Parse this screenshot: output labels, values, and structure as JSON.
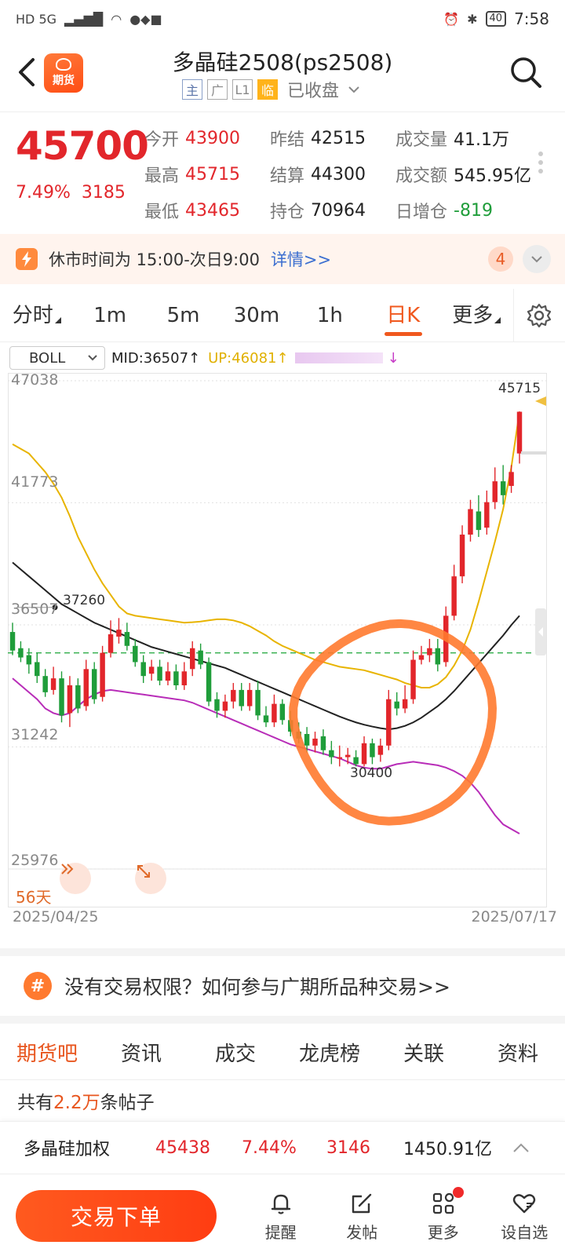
{
  "status_bar": {
    "left_text": "HD 5G",
    "time": "7:58",
    "battery": "40"
  },
  "header": {
    "logo_text": "期货",
    "title": "多晶硅2508(ps2508)",
    "tags": [
      "主",
      "广",
      "L1",
      "临"
    ],
    "market_status": "已收盘"
  },
  "quote": {
    "last_price": "45700",
    "change_pct": "7.49%",
    "change": "3185",
    "rows": [
      [
        {
          "label": "今开",
          "value": "43900",
          "color": "red"
        },
        {
          "label": "昨结",
          "value": "42515",
          "color": "dark"
        },
        {
          "label": "成交量",
          "value": "41.1万",
          "color": "dark"
        }
      ],
      [
        {
          "label": "最高",
          "value": "45715",
          "color": "red"
        },
        {
          "label": "结算",
          "value": "44300",
          "color": "dark"
        },
        {
          "label": "成交额",
          "value": "545.95亿",
          "color": "dark"
        }
      ],
      [
        {
          "label": "最低",
          "value": "43465",
          "color": "red"
        },
        {
          "label": "持仓",
          "value": "70964",
          "color": "dark"
        },
        {
          "label": "日增仓",
          "value": "-819",
          "color": "green"
        }
      ]
    ]
  },
  "notice": {
    "text": "休市时间为 15:00-次日9:00",
    "link": "详情>>",
    "badge": "4"
  },
  "period_tabs": [
    {
      "label": "分时",
      "corner": true
    },
    {
      "label": "1m"
    },
    {
      "label": "5m"
    },
    {
      "label": "30m"
    },
    {
      "label": "1h"
    },
    {
      "label": "日K",
      "active": true
    },
    {
      "label": "更多",
      "corner": true
    }
  ],
  "indicator": {
    "select": "BOLL",
    "mid": "MID:36507",
    "up": "UP:46081"
  },
  "chart_data": {
    "type": "candlestick",
    "indicator": "BOLL",
    "y_ticks": [
      "47038",
      "41773",
      "36507",
      "31242",
      "25976"
    ],
    "ylim": [
      25976,
      47038
    ],
    "x_start": "2025/04/25",
    "x_end": "2025/07/17",
    "range_label": "56天",
    "reference_price": 35300,
    "high_label": "45715",
    "low_label": "30400",
    "prior_high_label": "37260",
    "candles": [
      {
        "o": 36200,
        "c": 35400,
        "h": 36600,
        "l": 35200
      },
      {
        "o": 35500,
        "c": 35100,
        "h": 35800,
        "l": 34900
      },
      {
        "o": 35200,
        "c": 34800,
        "h": 35500,
        "l": 34400
      },
      {
        "o": 34900,
        "c": 34300,
        "h": 35300,
        "l": 34000
      },
      {
        "o": 34300,
        "c": 33600,
        "h": 34600,
        "l": 33400
      },
      {
        "o": 33700,
        "c": 34200,
        "h": 34700,
        "l": 33500
      },
      {
        "o": 34200,
        "c": 32600,
        "h": 34500,
        "l": 32300
      },
      {
        "o": 32700,
        "c": 33900,
        "h": 34300,
        "l": 32100
      },
      {
        "o": 33900,
        "c": 32900,
        "h": 34200,
        "l": 32700
      },
      {
        "o": 33000,
        "c": 34600,
        "h": 35000,
        "l": 32800
      },
      {
        "o": 34600,
        "c": 33300,
        "h": 34900,
        "l": 33100
      },
      {
        "o": 33400,
        "c": 35300,
        "h": 35600,
        "l": 33200
      },
      {
        "o": 35300,
        "c": 36100,
        "h": 36700,
        "l": 35100
      },
      {
        "o": 36000,
        "c": 36300,
        "h": 36800,
        "l": 35700
      },
      {
        "o": 36200,
        "c": 35600,
        "h": 36600,
        "l": 35400
      },
      {
        "o": 35600,
        "c": 34900,
        "h": 35900,
        "l": 34700
      },
      {
        "o": 34900,
        "c": 34300,
        "h": 35200,
        "l": 34000
      },
      {
        "o": 34400,
        "c": 34700,
        "h": 35000,
        "l": 34100
      },
      {
        "o": 34700,
        "c": 34100,
        "h": 35000,
        "l": 33900
      },
      {
        "o": 34100,
        "c": 34500,
        "h": 34900,
        "l": 33900
      },
      {
        "o": 34500,
        "c": 33900,
        "h": 34800,
        "l": 33700
      },
      {
        "o": 33900,
        "c": 34500,
        "h": 34900,
        "l": 33700
      },
      {
        "o": 34600,
        "c": 35500,
        "h": 35800,
        "l": 34300
      },
      {
        "o": 35400,
        "c": 34800,
        "h": 35700,
        "l": 34600
      },
      {
        "o": 34900,
        "c": 33200,
        "h": 35100,
        "l": 33000
      },
      {
        "o": 33300,
        "c": 32800,
        "h": 33600,
        "l": 32500
      },
      {
        "o": 32800,
        "c": 33200,
        "h": 33500,
        "l": 32500
      },
      {
        "o": 33200,
        "c": 33700,
        "h": 34000,
        "l": 32900
      },
      {
        "o": 33700,
        "c": 33000,
        "h": 34000,
        "l": 32800
      },
      {
        "o": 33000,
        "c": 33700,
        "h": 34000,
        "l": 32800
      },
      {
        "o": 33700,
        "c": 32600,
        "h": 34100,
        "l": 32400
      },
      {
        "o": 32600,
        "c": 32300,
        "h": 33000,
        "l": 32100
      },
      {
        "o": 32300,
        "c": 33100,
        "h": 33500,
        "l": 32100
      },
      {
        "o": 33100,
        "c": 32400,
        "h": 33300,
        "l": 32200
      },
      {
        "o": 32400,
        "c": 31900,
        "h": 32800,
        "l": 31700
      },
      {
        "o": 31900,
        "c": 31600,
        "h": 32300,
        "l": 31400
      },
      {
        "o": 31800,
        "c": 31300,
        "h": 32100,
        "l": 31000
      },
      {
        "o": 31300,
        "c": 31600,
        "h": 31900,
        "l": 31000
      },
      {
        "o": 31700,
        "c": 31100,
        "h": 32000,
        "l": 30900
      },
      {
        "o": 31100,
        "c": 30800,
        "h": 31500,
        "l": 30500
      },
      {
        "o": 30800,
        "c": 30800,
        "h": 31300,
        "l": 30400
      },
      {
        "o": 30800,
        "c": 30900,
        "h": 31200,
        "l": 30500
      },
      {
        "o": 30800,
        "c": 30500,
        "h": 31100,
        "l": 30400
      },
      {
        "o": 30500,
        "c": 31400,
        "h": 31700,
        "l": 30400
      },
      {
        "o": 31400,
        "c": 30800,
        "h": 31600,
        "l": 30500
      },
      {
        "o": 30900,
        "c": 31300,
        "h": 31600,
        "l": 30600
      },
      {
        "o": 31300,
        "c": 33300,
        "h": 33700,
        "l": 31100
      },
      {
        "o": 33200,
        "c": 32900,
        "h": 33600,
        "l": 32600
      },
      {
        "o": 32900,
        "c": 33300,
        "h": 33900,
        "l": 32700
      },
      {
        "o": 33300,
        "c": 35000,
        "h": 35400,
        "l": 33100
      },
      {
        "o": 35000,
        "c": 35200,
        "h": 35600,
        "l": 34800
      },
      {
        "o": 35200,
        "c": 35500,
        "h": 35900,
        "l": 34900
      },
      {
        "o": 35500,
        "c": 34800,
        "h": 35900,
        "l": 34500
      },
      {
        "o": 34900,
        "c": 36900,
        "h": 37300,
        "l": 34700
      },
      {
        "o": 36900,
        "c": 38600,
        "h": 39100,
        "l": 36700
      },
      {
        "o": 38600,
        "c": 40400,
        "h": 40800,
        "l": 38300
      },
      {
        "o": 40400,
        "c": 41500,
        "h": 41900,
        "l": 40100
      },
      {
        "o": 41400,
        "c": 40600,
        "h": 42100,
        "l": 40300
      },
      {
        "o": 40700,
        "c": 41800,
        "h": 42300,
        "l": 40400
      },
      {
        "o": 41800,
        "c": 42700,
        "h": 43300,
        "l": 41500
      },
      {
        "o": 42700,
        "c": 42100,
        "h": 43400,
        "l": 41700
      },
      {
        "o": 42500,
        "c": 43100,
        "h": 43400,
        "l": 42200
      },
      {
        "o": 43900,
        "c": 45700,
        "h": 45715,
        "l": 43465
      }
    ],
    "series": [
      {
        "name": "MID",
        "color": "#222222",
        "values": [
          39200,
          38900,
          38600,
          38300,
          38000,
          37700,
          37400,
          37200,
          37000,
          36800,
          36600,
          36450,
          36300,
          36150,
          36000,
          35850,
          35700,
          35550,
          35450,
          35350,
          35250,
          35150,
          35050,
          34950,
          34850,
          34750,
          34650,
          34500,
          34350,
          34200,
          34050,
          33900,
          33750,
          33600,
          33450,
          33300,
          33150,
          33000,
          32850,
          32700,
          32550,
          32420,
          32300,
          32200,
          32120,
          32050,
          32000,
          32050,
          32150,
          32300,
          32500,
          32750,
          33000,
          33300,
          33650,
          34050,
          34450,
          34850,
          35250,
          35650,
          36050,
          36500,
          36900
        ]
      },
      {
        "name": "UP",
        "color": "#e8b400",
        "values": [
          44300,
          44100,
          43900,
          43500,
          43100,
          42600,
          42000,
          41200,
          40300,
          39600,
          38900,
          38300,
          37800,
          37300,
          37000,
          36900,
          36850,
          36800,
          36750,
          36700,
          36650,
          36600,
          36620,
          36650,
          36700,
          36750,
          36750,
          36700,
          36600,
          36450,
          36250,
          36050,
          35800,
          35600,
          35450,
          35300,
          35150,
          35000,
          34900,
          34800,
          34700,
          34650,
          34600,
          34550,
          34450,
          34350,
          34250,
          34150,
          34000,
          33900,
          33800,
          33800,
          33950,
          34250,
          34750,
          35400,
          36300,
          37500,
          38800,
          40100,
          41500,
          43300,
          45700
        ]
      },
      {
        "name": "DN",
        "color": "#b82db8",
        "values": [
          34200,
          33900,
          33600,
          33300,
          32900,
          32700,
          32600,
          32700,
          33000,
          33300,
          33500,
          33650,
          33700,
          33650,
          33600,
          33550,
          33500,
          33450,
          33400,
          33350,
          33300,
          33250,
          33150,
          33000,
          32850,
          32700,
          32550,
          32400,
          32250,
          32100,
          31950,
          31800,
          31650,
          31500,
          31350,
          31250,
          31150,
          31050,
          30950,
          30850,
          30750,
          30600,
          30450,
          30350,
          30300,
          30300,
          30400,
          30500,
          30550,
          30600,
          30550,
          30500,
          30450,
          30350,
          30200,
          30000,
          29700,
          29300,
          28800,
          28300,
          27900,
          27700,
          27500
        ]
      }
    ]
  },
  "promo": {
    "icon": "#",
    "text": "没有交易权限？如何参与广期所品种交易>>"
  },
  "section_tabs": [
    {
      "label": "期货吧",
      "active": true
    },
    {
      "label": "资讯"
    },
    {
      "label": "成交"
    },
    {
      "label": "龙虎榜"
    },
    {
      "label": "关联"
    },
    {
      "label": "资料"
    }
  ],
  "posts": {
    "prefix": "共有",
    "count": "2.2万",
    "suffix": "条帖子"
  },
  "related": {
    "name": "多晶硅加权",
    "price": "45438",
    "pct": "7.44%",
    "change": "3146",
    "amount": "1450.91亿"
  },
  "bottom_bar": {
    "trade_label": "交易下单",
    "nav": [
      {
        "label": "提醒",
        "icon": "bell-icon"
      },
      {
        "label": "发帖",
        "icon": "edit-icon"
      },
      {
        "label": "更多",
        "icon": "grid-icon",
        "dot": true
      },
      {
        "label": "设自选",
        "icon": "heart-icon"
      }
    ]
  },
  "colors": {
    "accent": "#f0581e",
    "up": "#e2262b",
    "down": "#1f9d3a",
    "annotation": "#ff7a2f"
  }
}
